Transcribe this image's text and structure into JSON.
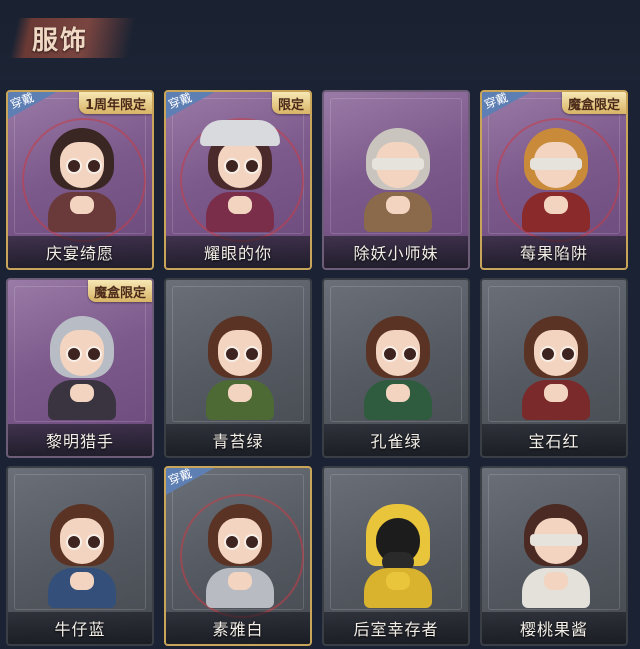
{
  "header": {
    "title": "服饰"
  },
  "badges": {
    "wear": "穿戴"
  },
  "cards": [
    {
      "name": "庆宴绮愿",
      "style": "purple",
      "worn": true,
      "tag": "1周年限定",
      "hair": "#3a2622",
      "body": "#6a3a3a"
    },
    {
      "name": "耀眼的你",
      "style": "purple",
      "worn": true,
      "tag": "限定",
      "hair": "#4a2a2a",
      "body": "#7a2e4a"
    },
    {
      "name": "除妖小师妹",
      "style": "purple-plain",
      "worn": false,
      "tag": "",
      "hair": "#c9c4bd",
      "body": "#8a6a4a"
    },
    {
      "name": "莓果陷阱",
      "style": "purple",
      "worn": true,
      "tag": "魔盒限定",
      "hair": "#c98a3a",
      "body": "#8a2a2a"
    },
    {
      "name": "黎明猎手",
      "style": "purple-plain",
      "worn": false,
      "tag": "魔盒限定",
      "hair": "#b8bcc4",
      "body": "#3a3440"
    },
    {
      "name": "青苔绿",
      "style": "grey",
      "worn": false,
      "tag": "",
      "hair": "#5a3325",
      "body": "#4e6a34"
    },
    {
      "name": "孔雀绿",
      "style": "grey",
      "worn": false,
      "tag": "",
      "hair": "#5a3325",
      "body": "#2f5c3e"
    },
    {
      "name": "宝石红",
      "style": "grey",
      "worn": false,
      "tag": "",
      "hair": "#5a3325",
      "body": "#7a2a2a"
    },
    {
      "name": "牛仔蓝",
      "style": "grey",
      "worn": false,
      "tag": "",
      "hair": "#5a3325",
      "body": "#34507a"
    },
    {
      "name": "素雅白",
      "style": "grey-gold",
      "worn": true,
      "tag": "",
      "hair": "#5a3325",
      "body": "#b8bcc2"
    },
    {
      "name": "后室幸存者",
      "style": "grey",
      "worn": false,
      "tag": "",
      "hair": "#e8c53a",
      "body": "#d9b22e"
    },
    {
      "name": "樱桃果酱",
      "style": "grey",
      "worn": false,
      "tag": "",
      "hair": "#4a2a22",
      "body": "#e4e0da"
    }
  ]
}
